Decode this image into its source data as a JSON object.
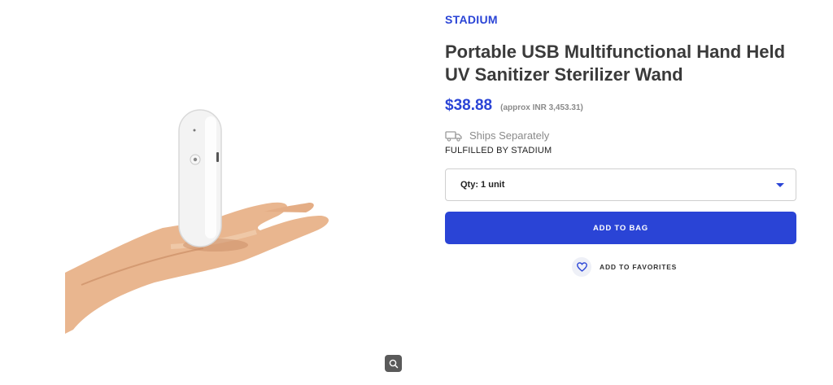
{
  "product": {
    "brand": "STADIUM",
    "title": "Portable USB Multifunctional Hand Held UV Sanitizer Sterilizer Wand",
    "price": "$38.88",
    "approx_price": "(approx INR 3,453.31)"
  },
  "shipping": {
    "ships_text": "Ships Separately",
    "fulfilled_text": "FULFILLED BY STADIUM"
  },
  "quantity": {
    "selected": "Qty: 1 unit"
  },
  "actions": {
    "add_to_bag": "ADD TO BAG",
    "add_to_favorites": "ADD TO FAVORITES"
  },
  "icons": {
    "zoom": "search-icon",
    "shipping": "truck-icon",
    "favorite": "heart-icon",
    "dropdown": "caret-down-icon"
  },
  "colors": {
    "accent": "#2a44d6",
    "muted_text": "#8a8a8a",
    "title_text": "#3a3a3a"
  }
}
